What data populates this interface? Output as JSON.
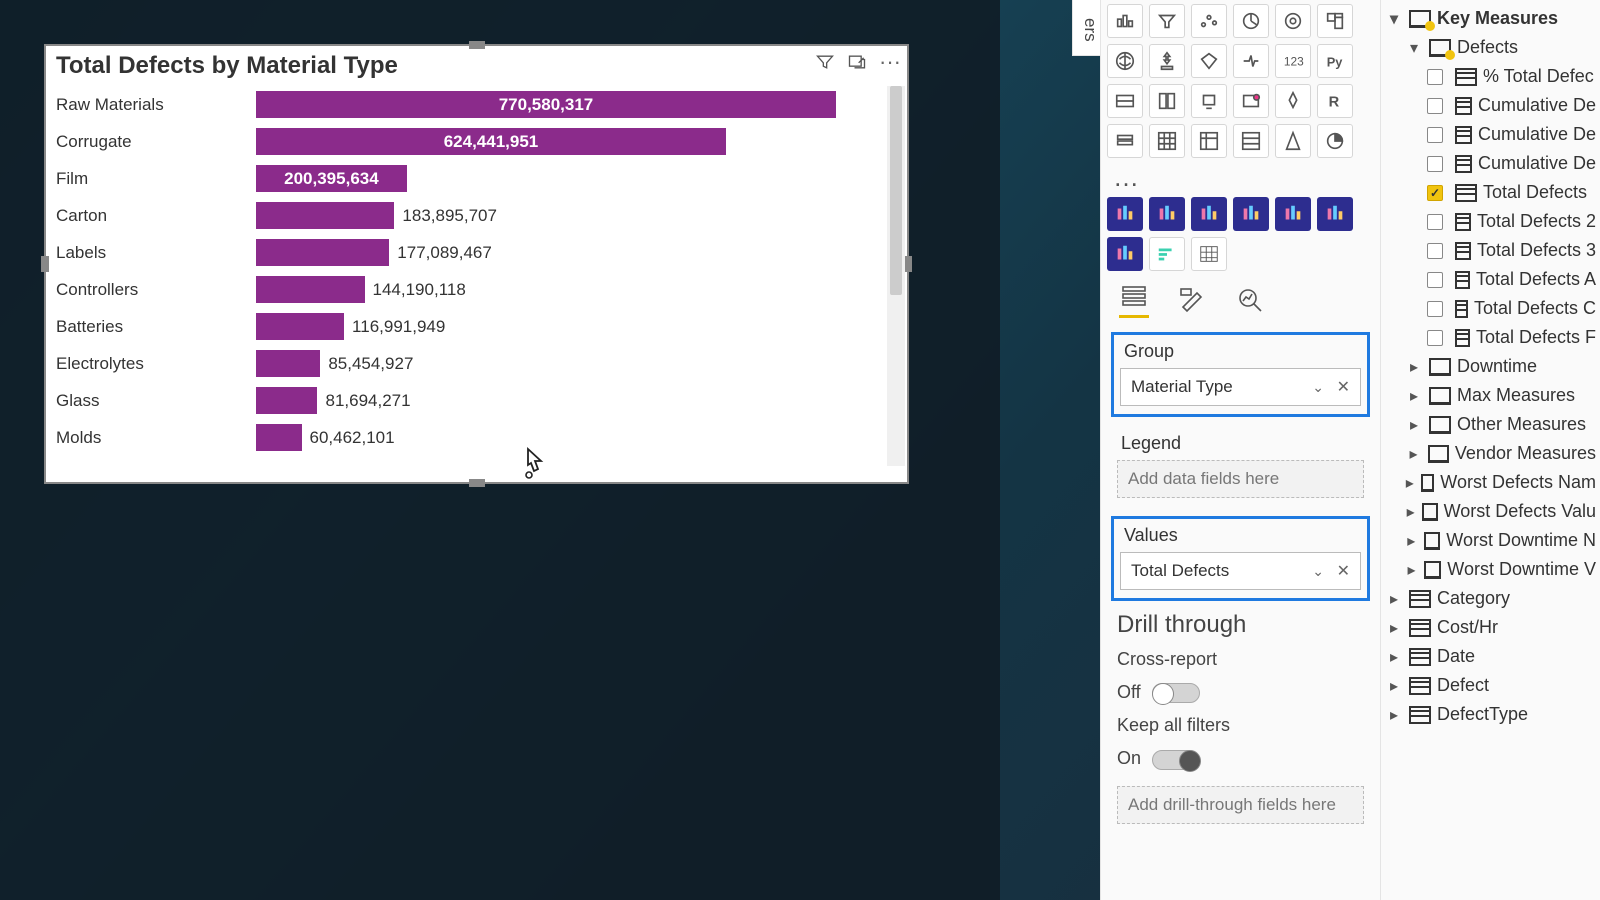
{
  "chart": {
    "title": "Total Defects by Material Type"
  },
  "chart_data": {
    "type": "bar",
    "orientation": "horizontal",
    "title": "Total Defects by Material Type",
    "xlabel": "",
    "ylabel": "",
    "categories": [
      "Raw Materials",
      "Corrugate",
      "Film",
      "Carton",
      "Labels",
      "Controllers",
      "Batteries",
      "Electrolytes",
      "Glass",
      "Molds"
    ],
    "values": [
      770580317,
      624441951,
      200395634,
      183895707,
      177089467,
      144190118,
      116991949,
      85454927,
      81694271,
      60462101
    ],
    "value_labels": [
      "770,580,317",
      "624,441,951",
      "200,395,634",
      "183,895,707",
      "177,089,467",
      "144,190,118",
      "116,991,949",
      "85,454,927",
      "81,694,271",
      "60,462,101"
    ],
    "color": "#8B2B8B"
  },
  "panels": {
    "filters_tab": "ers",
    "wells": {
      "group": {
        "label": "Group",
        "field": "Material Type"
      },
      "legend": {
        "label": "Legend",
        "placeholder": "Add data fields here"
      },
      "values": {
        "label": "Values",
        "field": "Total Defects"
      }
    },
    "drill": {
      "title": "Drill through",
      "cross": "Cross-report",
      "cross_state": "Off",
      "keep": "Keep all filters",
      "keep_state": "On",
      "placeholder": "Add drill-through fields here"
    },
    "viz_row_more": "…"
  },
  "fields": {
    "top": "Key Measures",
    "defects_group": "Defects",
    "measures": [
      {
        "label": "% Total Defec",
        "checked": false
      },
      {
        "label": "Cumulative De",
        "checked": false
      },
      {
        "label": "Cumulative De",
        "checked": false
      },
      {
        "label": "Cumulative De",
        "checked": false
      },
      {
        "label": "Total Defects",
        "checked": true
      },
      {
        "label": "Total Defects 2",
        "checked": false
      },
      {
        "label": "Total Defects 3",
        "checked": false
      },
      {
        "label": "Total Defects A",
        "checked": false
      },
      {
        "label": "Total Defects C",
        "checked": false
      },
      {
        "label": "Total Defects F",
        "checked": false
      }
    ],
    "folders": [
      "Downtime",
      "Max Measures",
      "Other Measures",
      "Vendor Measures",
      "Worst Defects Nam",
      "Worst Defects Valu",
      "Worst Downtime N",
      "Worst Downtime V"
    ],
    "tables": [
      "Category",
      "Cost/Hr",
      "Date",
      "Defect",
      "DefectType"
    ]
  }
}
